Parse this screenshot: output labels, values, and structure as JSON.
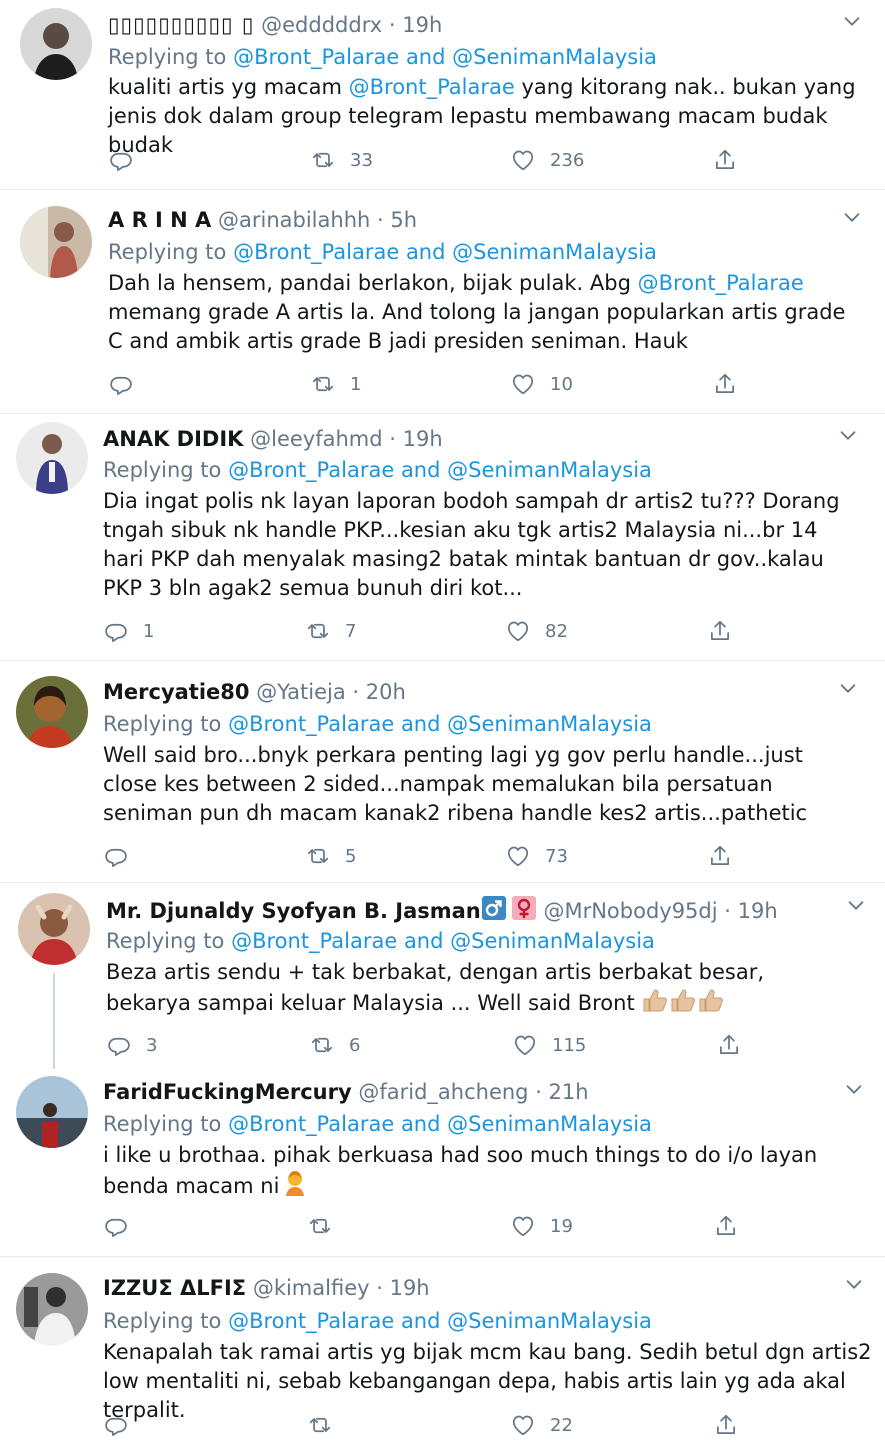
{
  "tweets": [
    {
      "name": "▯▯▯▯▯▯▯▯▯▯ ▯",
      "handle": "@edddddrx",
      "time": "· 19h",
      "replying_prefix": "Replying to ",
      "replying_to": "@Bront_Palarae and @SenimanMalaysia",
      "body_parts": [
        "kualiti artis yg macam ",
        "@Bront_Palarae",
        " yang kitorang nak.. bukan yang jenis dok dalam group telegram lepastu membawang macam budak budak"
      ],
      "reply_count": "",
      "retweet_count": "33",
      "like_count": "236"
    },
    {
      "name": "A R I N A",
      "handle": "@arinabilahhh",
      "time": "· 5h",
      "replying_prefix": "Replying to ",
      "replying_to": "@Bront_Palarae and @SenimanMalaysia",
      "body_parts": [
        "Dah la hensem, pandai berlakon, bijak pulak. Abg ",
        "@Bront_Palarae",
        " memang grade A artis la. And tolong la jangan popularkan artis grade C and ambik artis grade B jadi presiden seniman. Hauk"
      ],
      "reply_count": "",
      "retweet_count": "1",
      "like_count": "10"
    },
    {
      "name": "ANAK DIDIK",
      "handle": "@leeyfahmd",
      "time": "· 19h",
      "replying_prefix": "Replying to ",
      "replying_to": "@Bront_Palarae and @SenimanMalaysia",
      "body": "Dia ingat polis nk layan laporan bodoh sampah dr artis2 tu??? Dorang tngah sibuk nk handle PKP...kesian aku tgk artis2 Malaysia ni...br 14 hari PKP dah menyalak masing2 batak mintak bantuan dr gov..kalau PKP 3 bln agak2 semua bunuh diri kot...",
      "reply_count": "1",
      "retweet_count": "7",
      "like_count": "82"
    },
    {
      "name": "Mercyatie80",
      "handle": "@Yatieja",
      "time": "· 20h",
      "replying_prefix": "Replying to ",
      "replying_to": "@Bront_Palarae and @SenimanMalaysia",
      "body": "Well said bro...bnyk perkara penting lagi yg gov perlu handle...just close kes between 2 sided...nampak memalukan bila persatuan seniman pun dh macam kanak2 ribena handle kes2 artis...pathetic",
      "reply_count": "",
      "retweet_count": "5",
      "like_count": "73"
    },
    {
      "name": "Mr. Djunaldy Syofyan B. Jasman",
      "handle": "@MrNobody95dj",
      "time": "· 19h",
      "replying_prefix": "Replying to ",
      "replying_to": "@Bront_Palarae and @SenimanMalaysia",
      "body": "Beza artis sendu + tak berbakat, dengan artis berbakat besar, bekarya sampai keluar Malaysia ... Well said Bront",
      "reply_count": "3",
      "retweet_count": "6",
      "like_count": "115"
    },
    {
      "name": "FaridFuckingMercury",
      "handle": "@farid_ahcheng",
      "time": "· 21h",
      "replying_prefix": "Replying to ",
      "replying_to": "@Bront_Palarae and @SenimanMalaysia",
      "body": "i like u brothaa. pihak berkuasa had soo much things to do i/o layan benda macam ni",
      "reply_count": "",
      "retweet_count": "",
      "like_count": "19"
    },
    {
      "name": "IZZUΣ ΔLFIΣ",
      "handle": "@kimalfiey",
      "time": "· 19h",
      "replying_prefix": "Replying to ",
      "replying_to": "@Bront_Palarae and @SenimanMalaysia",
      "body": "Kenapalah tak ramai artis yg bijak mcm kau bang. Sedih betul dgn artis2 low mentaliti ni, sebab kebangangan depa, habis artis lain yg ada akal terpalit.",
      "reply_count": "",
      "retweet_count": "",
      "like_count": "22"
    }
  ],
  "colors": {
    "link": "#1b95e0",
    "muted": "#657786",
    "text": "#14171a",
    "divider": "#e6ecf0"
  }
}
